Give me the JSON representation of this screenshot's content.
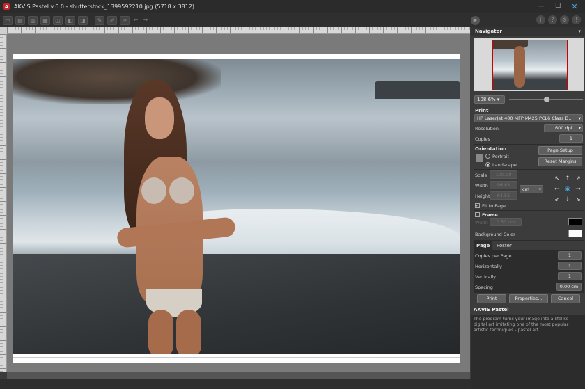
{
  "window": {
    "title": "AKVIS Pastel v.6.0 - shutterstock_1399592210.jpg (5718 x 3812)",
    "logo_letter": "A",
    "minimize": "—",
    "maximize": "☐",
    "close": "✕"
  },
  "toolbar": {
    "buttons": [
      "open-icon",
      "save-icon",
      "batch-icon",
      "print-icon",
      "export-icon",
      "share-icon",
      "settings-icon",
      "brush-icon",
      "eraser-icon",
      "history-icon"
    ],
    "right_icons": [
      "info-icon",
      "help-icon",
      "gear-icon",
      "notification-icon"
    ]
  },
  "navigator": {
    "title": "Navigator",
    "collapse": "▾",
    "zoom": "108.6%"
  },
  "print": {
    "section_label": "Print",
    "printer": "HP LaserJet 400 MFP M425 PCL6 Class D...",
    "resolution_label": "Resolution",
    "resolution_value": "600 dpi",
    "copies_label": "Copies",
    "copies_value": "1",
    "orientation_label": "Orientation",
    "portrait_label": "Portrait",
    "landscape_label": "Landscape",
    "page_setup_label": "Page Setup",
    "reset_margins_label": "Reset Margins",
    "scale_label": "Scale",
    "scale_value": "100.00",
    "width_label": "Width",
    "width_value": "96.83",
    "height_label": "Height",
    "height_value": "64.55",
    "unit": "cm",
    "fit_to_page_label": "Fit to Page",
    "frame_label": "Frame",
    "frame_width_label": "Width",
    "frame_width_value": "0.50 cm",
    "frame_color": "#000000",
    "background_color_label": "Background Color",
    "background_color": "#ffffff"
  },
  "tabs": {
    "page": "Page",
    "poster": "Poster"
  },
  "page_tab": {
    "copies_per_page_label": "Copies per Page",
    "copies_per_page_value": "1",
    "horizontally_label": "Horizontally",
    "horizontally_value": "1",
    "vertically_label": "Vertically",
    "vertically_value": "1",
    "spacing_label": "Spacing",
    "spacing_value": "0,00 cm"
  },
  "actions": {
    "print": "Print",
    "properties": "Properties...",
    "cancel": "Cancel"
  },
  "description": {
    "title": "AKVIS Pastel",
    "text": "The program turns your image into a lifelike digital art imitating one of the most popular artistic techniques - pastel art."
  }
}
